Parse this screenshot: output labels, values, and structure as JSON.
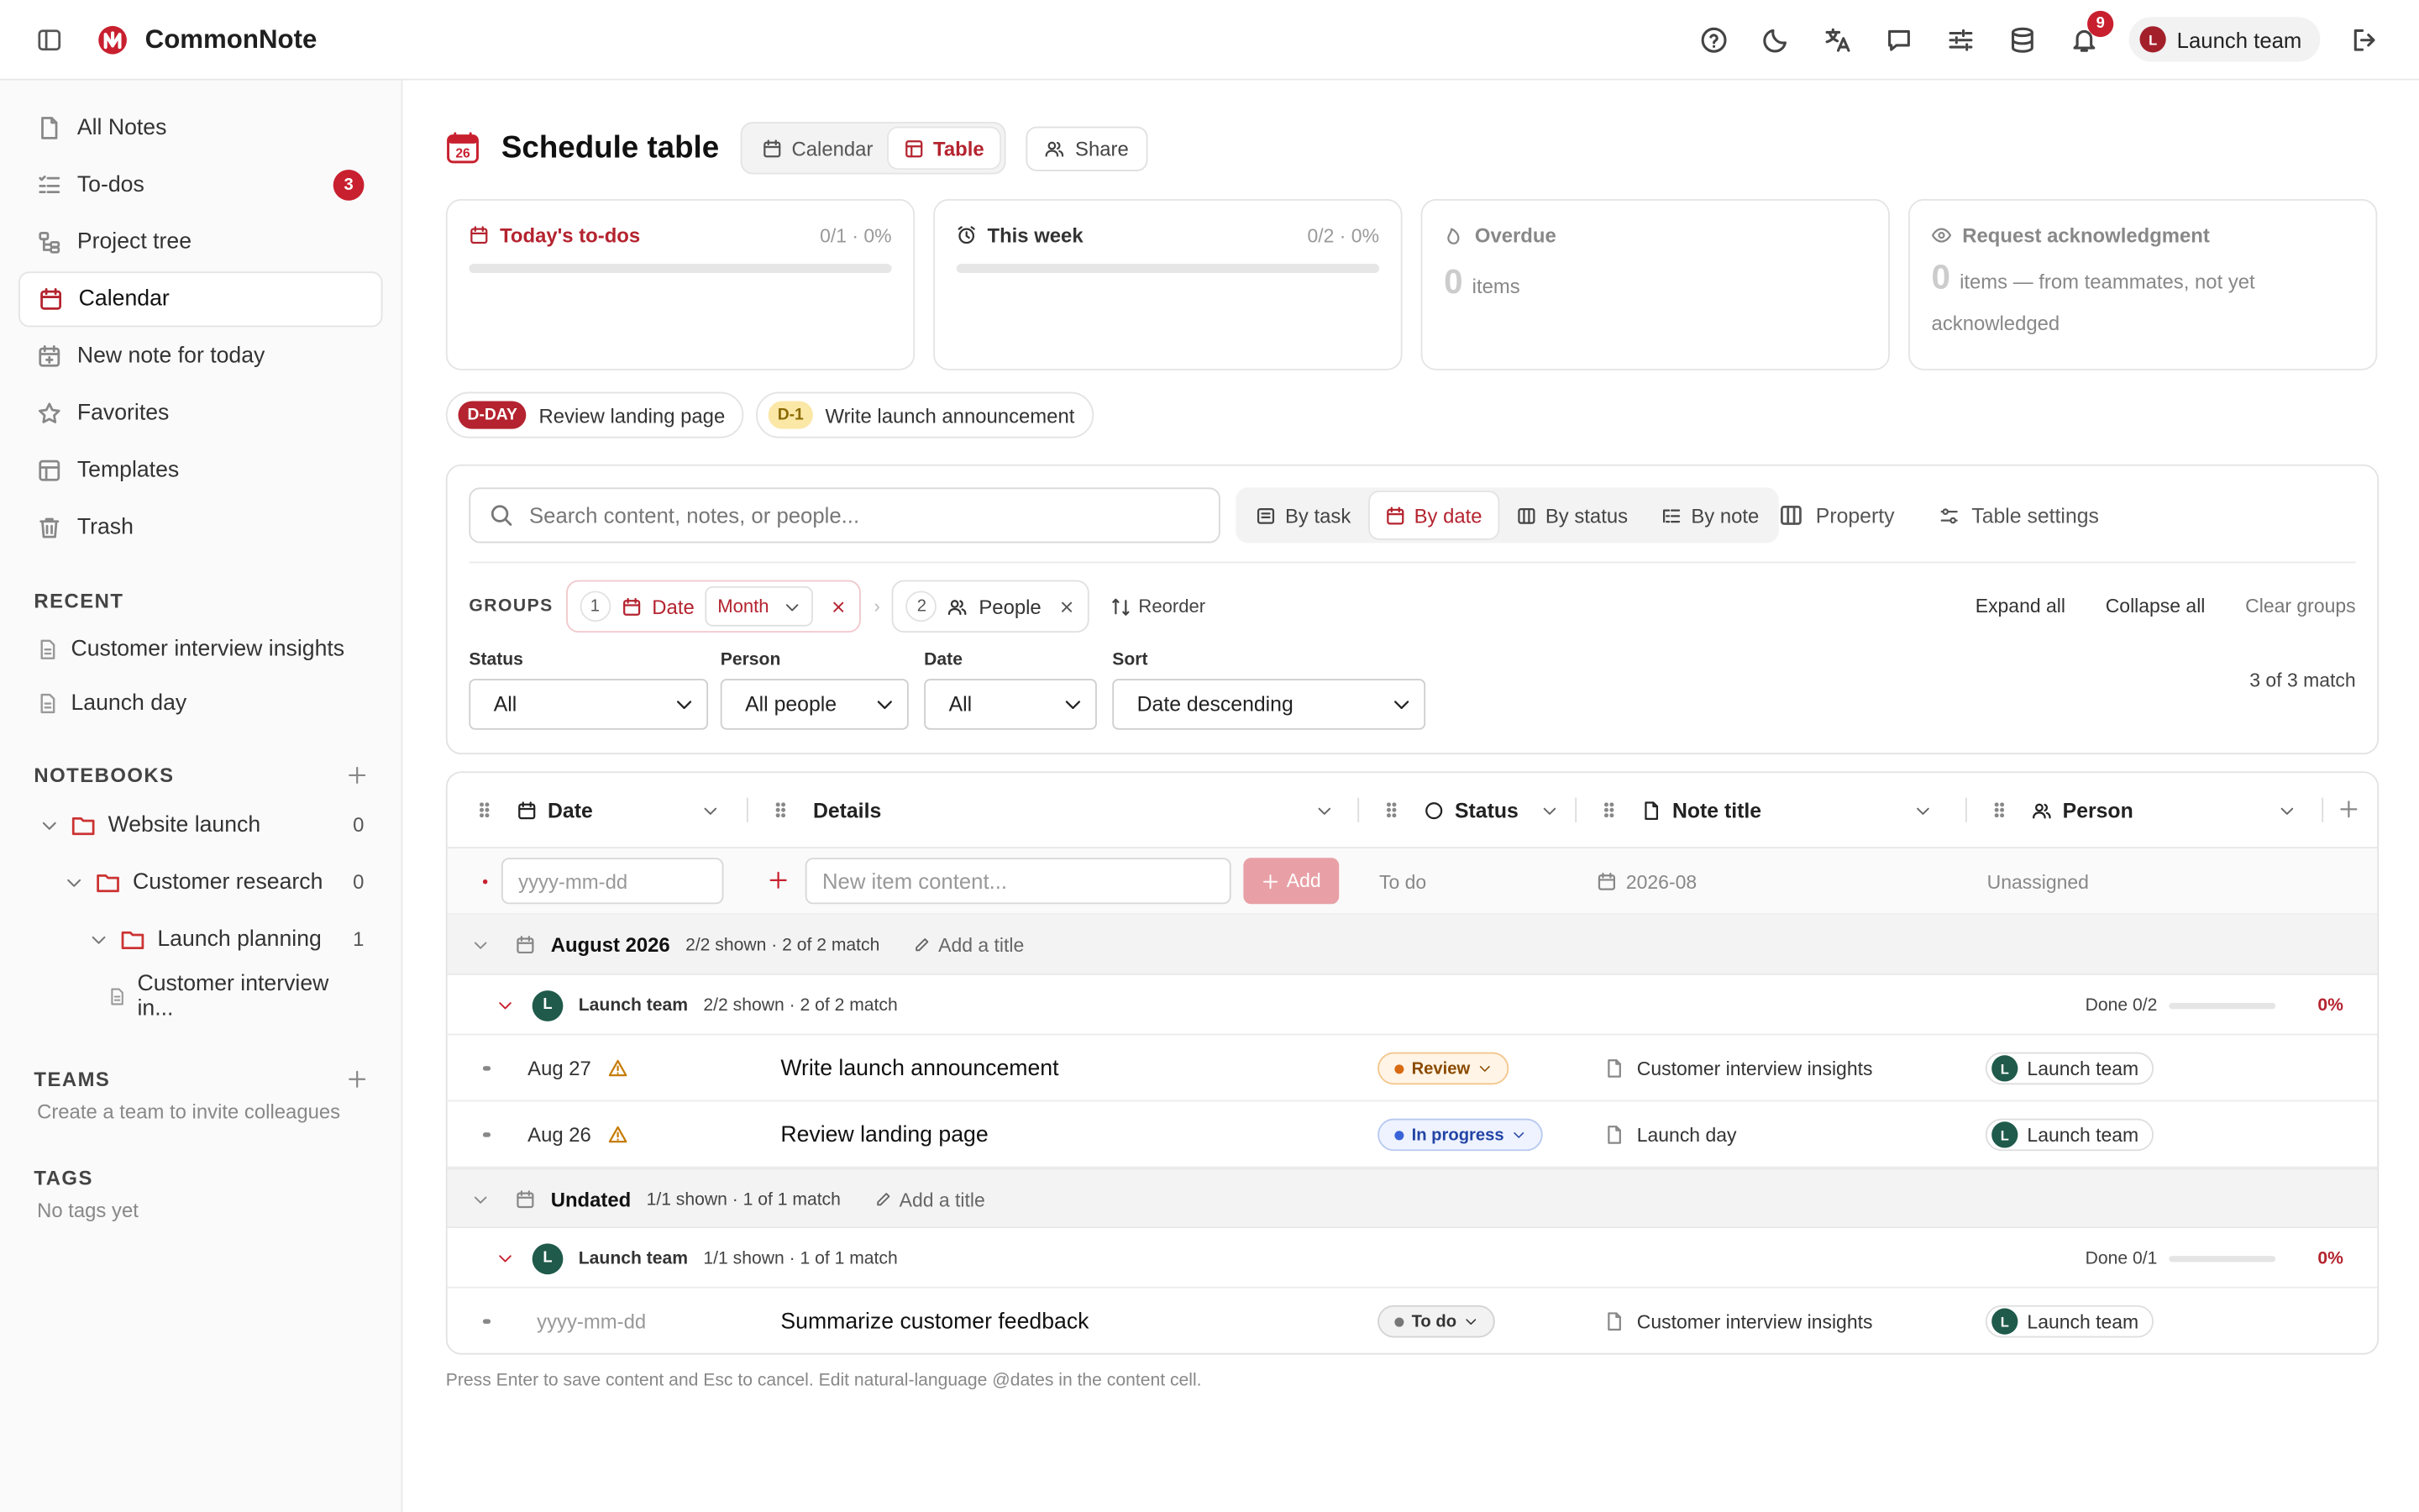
{
  "app": {
    "name": "CommonNote"
  },
  "header": {
    "notifications_count": "9",
    "team_initial": "L",
    "team_name": "Launch team"
  },
  "sidebar": {
    "nav": [
      {
        "label": "All Notes",
        "icon": "note-icon"
      },
      {
        "label": "To-dos",
        "icon": "checklist-icon",
        "badge": "3"
      },
      {
        "label": "Project tree",
        "icon": "tree-icon"
      },
      {
        "label": "Calendar",
        "icon": "calendar-icon"
      },
      {
        "label": "New note for today",
        "icon": "calendar-plus-icon"
      },
      {
        "label": "Favorites",
        "icon": "star-icon"
      },
      {
        "label": "Templates",
        "icon": "template-icon"
      },
      {
        "label": "Trash",
        "icon": "trash-icon"
      }
    ],
    "recent_heading": "RECENT",
    "recent": [
      "Customer interview insights",
      "Launch day"
    ],
    "notebooks_heading": "NOTEBOOKS",
    "notebooks": [
      {
        "label": "Website launch",
        "count": "0"
      },
      {
        "label": "Customer research",
        "count": "0"
      },
      {
        "label": "Launch planning",
        "count": "1"
      },
      {
        "label": "Customer interview in..."
      }
    ],
    "teams_heading": "TEAMS",
    "teams_empty": "Create a team to invite colleagues",
    "tags_heading": "TAGS",
    "tags_empty": "No tags yet"
  },
  "page": {
    "calendar_day": "26",
    "title": "Schedule table",
    "view_calendar": "Calendar",
    "view_table": "Table",
    "share": "Share"
  },
  "cards": {
    "today": {
      "title": "Today's to-dos",
      "frac": "0/1 · 0%",
      "progress": 0
    },
    "week": {
      "title": "This week",
      "frac": "0/2 · 0%",
      "progress": 0
    },
    "overdue": {
      "title": "Overdue",
      "count": "0",
      "text": "items"
    },
    "ack": {
      "title": "Request acknowledgment",
      "count": "0",
      "text": "items — from teammates, not yet acknowledged"
    }
  },
  "chips": [
    {
      "tag": "D-DAY",
      "label": "Review landing page"
    },
    {
      "tag": "D-1",
      "label": "Write launch announcement"
    }
  ],
  "filters": {
    "search_placeholder": "Search content, notes, or people...",
    "group_tabs": [
      "By task",
      "By date",
      "By status",
      "By note"
    ],
    "property": "Property",
    "table_settings": "Table settings",
    "groups_label": "GROUPS",
    "group1": {
      "num": "1",
      "label": "Date",
      "sub": "Month"
    },
    "group2": {
      "num": "2",
      "label": "People"
    },
    "reorder": "Reorder",
    "expand_all": "Expand all",
    "collapse_all": "Collapse all",
    "clear_groups": "Clear groups",
    "status_label": "Status",
    "status_value": "All",
    "person_label": "Person",
    "person_value": "All people",
    "date_label": "Date",
    "date_value": "All",
    "sort_label": "Sort",
    "sort_value": "Date descending",
    "match": "3 of 3 match"
  },
  "table": {
    "columns": [
      "Date",
      "Details",
      "Status",
      "Note title",
      "Person"
    ],
    "new_row": {
      "date_placeholder": "yyyy-mm-dd",
      "content_placeholder": "New item content...",
      "add": "Add",
      "status": "To do",
      "note": "2026-08",
      "person": "Unassigned"
    },
    "groups": [
      {
        "title": "August 2026",
        "meta": "2/2 shown · 2 of 2 match",
        "add_title": "Add a title",
        "team": {
          "initial": "L",
          "name": "Launch team",
          "meta": "2/2 shown · 2 of 2 match",
          "done": "Done 0/2",
          "pct": "0%",
          "progress": 0
        },
        "rows": [
          {
            "date": "Aug 27",
            "details": "Write launch announcement",
            "status": "Review",
            "note": "Customer interview insights",
            "person": "Launch team"
          },
          {
            "date": "Aug 26",
            "details": "Review landing page",
            "status": "In progress",
            "note": "Launch day",
            "person": "Launch team"
          }
        ]
      },
      {
        "title": "Undated",
        "meta": "1/1 shown · 1 of 1 match",
        "add_title": "Add a title",
        "team": {
          "initial": "L",
          "name": "Launch team",
          "meta": "1/1 shown · 1 of 1 match",
          "done": "Done 0/1",
          "pct": "0%",
          "progress": 0
        },
        "rows": [
          {
            "date": "yyyy-mm-dd",
            "details": "Summarize customer feedback",
            "status": "To do",
            "note": "Customer interview insights",
            "person": "Launch team"
          }
        ]
      }
    ],
    "footer": "Press Enter to save content and Esc to cancel. Edit natural-language @dates in the content cell."
  }
}
